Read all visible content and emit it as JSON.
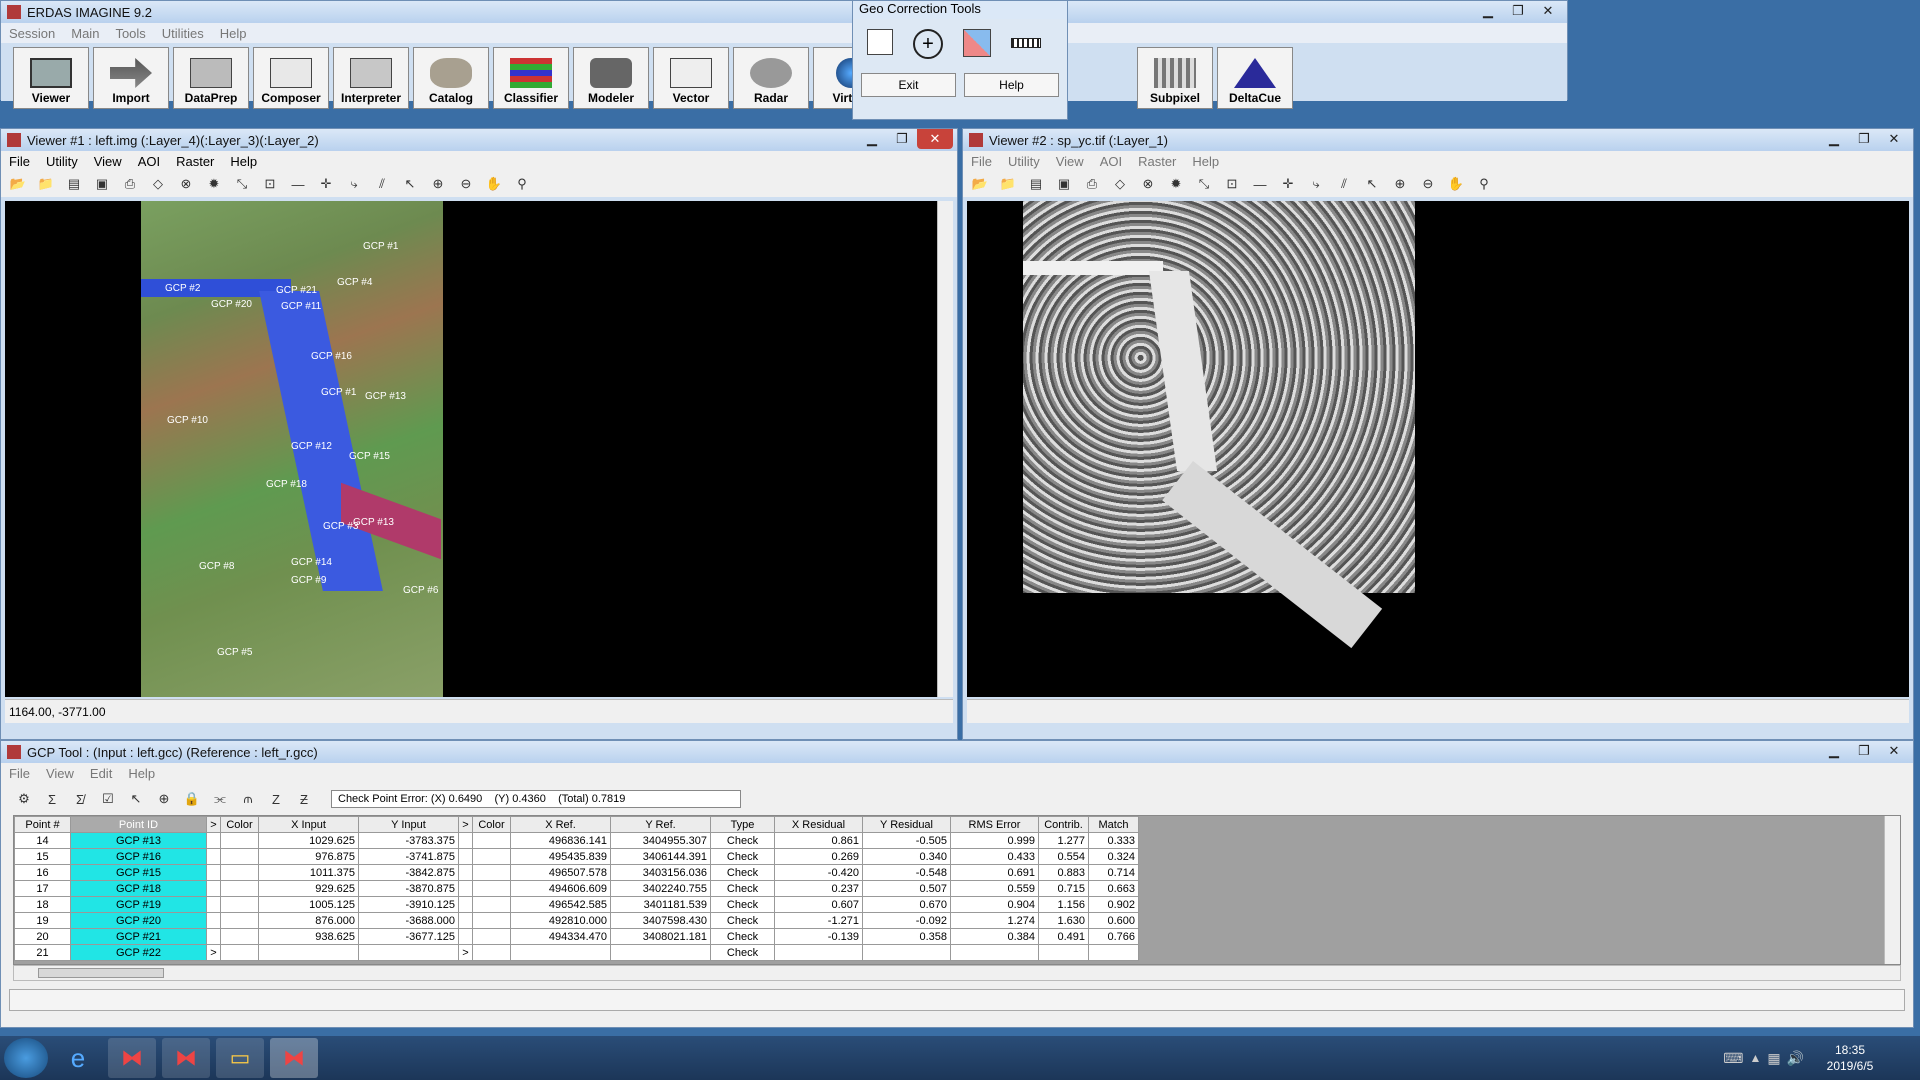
{
  "app": {
    "title": "ERDAS IMAGINE 9.2",
    "menu": [
      "Session",
      "Main",
      "Tools",
      "Utilities",
      "Help"
    ],
    "toolbar": [
      "Viewer",
      "Import",
      "DataPrep",
      "Composer",
      "Interpreter",
      "Catalog",
      "Classifier",
      "Modeler",
      "Vector",
      "Radar",
      "Virtual",
      "Subpixel",
      "DeltaCue"
    ]
  },
  "geo_tools": {
    "title": "Geo Correction Tools",
    "exit": "Exit",
    "help": "Help"
  },
  "viewer1": {
    "title": "Viewer #1 : left.img (:Layer_4)(:Layer_3)(:Layer_2)",
    "menu": [
      "File",
      "Utility",
      "View",
      "AOI",
      "Raster",
      "Help"
    ],
    "status": "1164.00, -3771.00",
    "gcps": [
      "GCP #2",
      "GCP #20",
      "GCP #21",
      "GCP #11",
      "GCP #1",
      "GCP #4",
      "GCP #16",
      "GCP #1",
      "GCP #13",
      "GCP #10",
      "GCP #12",
      "GCP #15",
      "GCP #18",
      "GCP #3",
      "GCP #13",
      "GCP #8",
      "GCP #14",
      "GCP #9",
      "GCP #6",
      "GCP #5"
    ]
  },
  "viewer2": {
    "title": "Viewer #2 : sp_yc.tif (:Layer_1)",
    "menu": [
      "File",
      "Utility",
      "View",
      "AOI",
      "Raster",
      "Help"
    ]
  },
  "gcp_tool": {
    "title": "GCP Tool : (Input : left.gcc) (Reference : left_r.gcc)",
    "menu": [
      "File",
      "View",
      "Edit",
      "Help"
    ],
    "check_error": "Check Point Error: (X) 0.6490    (Y) 0.4360    (Total) 0.7819",
    "columns": [
      "Point #",
      "Point ID",
      ">",
      "Color",
      "X Input",
      "Y Input",
      ">",
      "Color",
      "X Ref.",
      "Y Ref.",
      "Type",
      "X Residual",
      "Y Residual",
      "RMS Error",
      "Contrib.",
      "Match"
    ],
    "rows": [
      [
        "14",
        "GCP #13",
        "",
        "",
        "1029.625",
        "-3783.375",
        "",
        "",
        "496836.141",
        "3404955.307",
        "Check",
        "0.861",
        "-0.505",
        "0.999",
        "1.277",
        "0.333"
      ],
      [
        "15",
        "GCP #16",
        "",
        "",
        "976.875",
        "-3741.875",
        "",
        "",
        "495435.839",
        "3406144.391",
        "Check",
        "0.269",
        "0.340",
        "0.433",
        "0.554",
        "0.324"
      ],
      [
        "16",
        "GCP #15",
        "",
        "",
        "1011.375",
        "-3842.875",
        "",
        "",
        "496507.578",
        "3403156.036",
        "Check",
        "-0.420",
        "-0.548",
        "0.691",
        "0.883",
        "0.714"
      ],
      [
        "17",
        "GCP #18",
        "",
        "",
        "929.625",
        "-3870.875",
        "",
        "",
        "494606.609",
        "3402240.755",
        "Check",
        "0.237",
        "0.507",
        "0.559",
        "0.715",
        "0.663"
      ],
      [
        "18",
        "GCP #19",
        "",
        "",
        "1005.125",
        "-3910.125",
        "",
        "",
        "496542.585",
        "3401181.539",
        "Check",
        "0.607",
        "0.670",
        "0.904",
        "1.156",
        "0.902"
      ],
      [
        "19",
        "GCP #20",
        "",
        "",
        "876.000",
        "-3688.000",
        "",
        "",
        "492810.000",
        "3407598.430",
        "Check",
        "-1.271",
        "-0.092",
        "1.274",
        "1.630",
        "0.600"
      ],
      [
        "20",
        "GCP #21",
        "",
        "",
        "938.625",
        "-3677.125",
        "",
        "",
        "494334.470",
        "3408021.181",
        "Check",
        "-0.139",
        "0.358",
        "0.384",
        "0.491",
        "0.766"
      ],
      [
        "21",
        "GCP #22",
        ">",
        "",
        "",
        "",
        ">",
        "",
        "",
        "",
        "Check",
        "",
        "",
        "",
        "",
        ""
      ]
    ]
  },
  "taskbar": {
    "time": "18:35",
    "date": "2019/6/5"
  }
}
